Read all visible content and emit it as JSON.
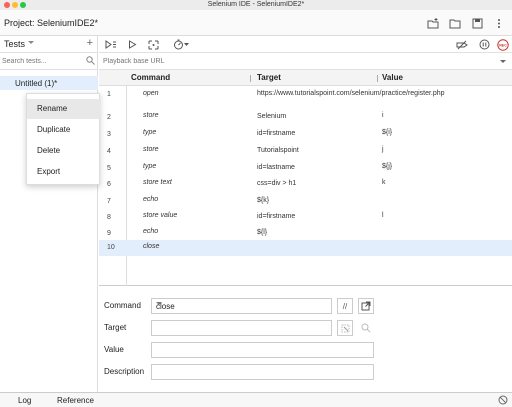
{
  "window": {
    "title": "Selenium IDE - SeleniumIDE2*"
  },
  "project": {
    "label": "Project:",
    "name": "SeleniumIDE2*"
  },
  "sidebar": {
    "tests_label": "Tests",
    "add_label": "+",
    "search_placeholder": "Search tests...",
    "test_name": "Untitled (1)*"
  },
  "context_menu": {
    "items": [
      {
        "label": "Rename"
      },
      {
        "label": "Duplicate"
      },
      {
        "label": "Delete"
      },
      {
        "label": "Export"
      }
    ]
  },
  "toolbar": {
    "base_url_placeholder": "Playback base URL",
    "rec_label": "REC"
  },
  "grid": {
    "headers": {
      "command": "Command",
      "target": "Target",
      "value": "Value"
    },
    "rows": [
      {
        "n": "1",
        "command": "open",
        "target": "https://www.tutorialspoint.com/selenium/practice/register.php",
        "value": ""
      },
      {
        "n": "2",
        "command": "store",
        "target": "Selenium",
        "value": "i"
      },
      {
        "n": "3",
        "command": "type",
        "target": "id=firstname",
        "value": "${i}"
      },
      {
        "n": "4",
        "command": "store",
        "target": "Tutorialspoint",
        "value": "j"
      },
      {
        "n": "5",
        "command": "type",
        "target": "id=lastname",
        "value": "${j}"
      },
      {
        "n": "6",
        "command": "store text",
        "target": "css=div > h1",
        "value": "k"
      },
      {
        "n": "7",
        "command": "echo",
        "target": "${k}",
        "value": ""
      },
      {
        "n": "8",
        "command": "store value",
        "target": "id=firstname",
        "value": "l"
      },
      {
        "n": "9",
        "command": "echo",
        "target": "${l}",
        "value": ""
      },
      {
        "n": "10",
        "command": "close",
        "target": "",
        "value": ""
      }
    ]
  },
  "editor": {
    "command_label": "Command",
    "command_value": "close",
    "comment_button": "//",
    "target_label": "Target",
    "value_label": "Value",
    "description_label": "Description"
  },
  "bottom": {
    "log_tab": "Log",
    "reference_tab": "Reference"
  }
}
